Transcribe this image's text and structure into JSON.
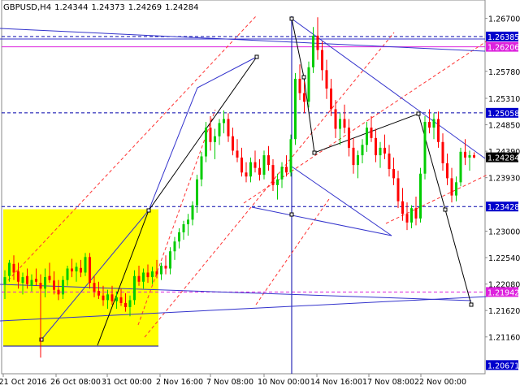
{
  "header": {
    "symbol": "GBPUSD,H4",
    "open": "1.24344",
    "high": "1.24373",
    "low": "1.24269",
    "close": "1.24284"
  },
  "colors": {
    "bull": "#00cc00",
    "bear": "#ff0000",
    "grid": "#c8c8c8",
    "level": "#0000aa",
    "channel": "#ff3333",
    "magenta": "#dd22dd",
    "pattern": "#3333cc",
    "zone": "#ffff00",
    "label_bg": "#0000cc"
  },
  "chart_data": {
    "type": "candlestick",
    "instrument": "GBPUSD",
    "timeframe": "H4",
    "ylim": [
      1.2052,
      1.2702
    ],
    "y_ticks": [
      "1.26700",
      "1.26385",
      "1.26206",
      "1.25780",
      "1.25310",
      "1.25058",
      "1.24850",
      "1.24390",
      "1.24284",
      "1.23930",
      "1.23428",
      "1.23000",
      "1.22540",
      "1.22080",
      "1.21942",
      "1.21620",
      "1.21160",
      "1.20671"
    ],
    "x_ticks": [
      "21 Oct 2016",
      "26 Oct 08:00",
      "31 Oct 00:00",
      "2 Nov 16:00",
      "7 Nov 08:00",
      "10 Nov 00:00",
      "14 Nov 16:00",
      "17 Nov 08:00",
      "22 Nov 00:00"
    ],
    "levels": [
      {
        "label": "1.26385",
        "value": 1.26385,
        "style": "dashed",
        "color": "#0000aa"
      },
      {
        "label": "1.26206",
        "value": 1.26206,
        "style": "solid",
        "color": "#dd22dd"
      },
      {
        "label": "1.25058",
        "value": 1.25058,
        "style": "dashed",
        "color": "#0000aa"
      },
      {
        "label": "1.24284",
        "value": 1.24284,
        "style": "current",
        "color": "#0000aa"
      },
      {
        "label": "1.23428",
        "value": 1.23428,
        "style": "dashed",
        "color": "#0000aa"
      },
      {
        "label": "1.21942",
        "value": 1.21942,
        "style": "dashed",
        "color": "#dd22dd"
      },
      {
        "label": "1.20671",
        "value": 1.20671,
        "style": "bottom",
        "color": "#0000aa"
      }
    ],
    "candles": [
      [
        1.2207,
        1.2232,
        1.2182,
        1.222
      ],
      [
        1.2222,
        1.225,
        1.2212,
        1.2245
      ],
      [
        1.2243,
        1.2258,
        1.2215,
        1.2228
      ],
      [
        1.223,
        1.2245,
        1.22,
        1.2212
      ],
      [
        1.221,
        1.2228,
        1.219,
        1.222
      ],
      [
        1.2222,
        1.2235,
        1.22,
        1.2208
      ],
      [
        1.2205,
        1.2225,
        1.2195,
        1.2215
      ],
      [
        1.2217,
        1.2235,
        1.2205,
        1.2212
      ],
      [
        1.221,
        1.2225,
        1.208,
        1.22
      ],
      [
        1.22,
        1.2235,
        1.2185,
        1.222
      ],
      [
        1.2222,
        1.2245,
        1.221,
        1.2215
      ],
      [
        1.2214,
        1.223,
        1.219,
        1.2198
      ],
      [
        1.2198,
        1.2215,
        1.218,
        1.219
      ],
      [
        1.219,
        1.2222,
        1.2182,
        1.2215
      ],
      [
        1.2215,
        1.224,
        1.2205,
        1.2235
      ],
      [
        1.2235,
        1.2252,
        1.222,
        1.223
      ],
      [
        1.223,
        1.2245,
        1.2212,
        1.2238
      ],
      [
        1.2236,
        1.225,
        1.222,
        1.2228
      ],
      [
        1.2228,
        1.2262,
        1.2222,
        1.2255
      ],
      [
        1.2255,
        1.2262,
        1.22,
        1.221
      ],
      [
        1.221,
        1.2222,
        1.2185,
        1.2195
      ],
      [
        1.2196,
        1.2212,
        1.2182,
        1.2188
      ],
      [
        1.2188,
        1.2205,
        1.217,
        1.218
      ],
      [
        1.218,
        1.2198,
        1.2165,
        1.219
      ],
      [
        1.219,
        1.2205,
        1.2172,
        1.2178
      ],
      [
        1.2178,
        1.2195,
        1.2165,
        1.2185
      ],
      [
        1.2185,
        1.22,
        1.217,
        1.2175
      ],
      [
        1.2175,
        1.2192,
        1.216,
        1.2168
      ],
      [
        1.2168,
        1.2188,
        1.2152,
        1.218
      ],
      [
        1.218,
        1.2232,
        1.2172,
        1.2222
      ],
      [
        1.2222,
        1.224,
        1.2205,
        1.2212
      ],
      [
        1.2212,
        1.2235,
        1.22,
        1.2228
      ],
      [
        1.2228,
        1.2242,
        1.221,
        1.222
      ],
      [
        1.222,
        1.2238,
        1.2208,
        1.223
      ],
      [
        1.223,
        1.225,
        1.2218,
        1.2225
      ],
      [
        1.2225,
        1.2245,
        1.2215,
        1.224
      ],
      [
        1.224,
        1.2258,
        1.2225,
        1.2235
      ],
      [
        1.2235,
        1.2272,
        1.2225,
        1.2265
      ],
      [
        1.2265,
        1.229,
        1.225,
        1.2282
      ],
      [
        1.2282,
        1.2305,
        1.227,
        1.2298
      ],
      [
        1.2298,
        1.2318,
        1.2285,
        1.2312
      ],
      [
        1.2312,
        1.233,
        1.2292,
        1.232
      ],
      [
        1.232,
        1.2352,
        1.231,
        1.2345
      ],
      [
        1.2345,
        1.2398,
        1.2332,
        1.239
      ],
      [
        1.239,
        1.2438,
        1.2378,
        1.243
      ],
      [
        1.243,
        1.249,
        1.242,
        1.248
      ],
      [
        1.248,
        1.25,
        1.244,
        1.2455
      ],
      [
        1.2455,
        1.2478,
        1.2425,
        1.2465
      ],
      [
        1.2465,
        1.2495,
        1.245,
        1.2488
      ],
      [
        1.2488,
        1.251,
        1.247,
        1.2495
      ],
      [
        1.2495,
        1.2505,
        1.2455,
        1.2465
      ],
      [
        1.2465,
        1.248,
        1.2432,
        1.244
      ],
      [
        1.244,
        1.246,
        1.242,
        1.2428
      ],
      [
        1.2428,
        1.2445,
        1.2395,
        1.2402
      ],
      [
        1.2402,
        1.242,
        1.2385,
        1.2395
      ],
      [
        1.2395,
        1.2428,
        1.2385,
        1.242
      ],
      [
        1.242,
        1.244,
        1.2402,
        1.241
      ],
      [
        1.241,
        1.2425,
        1.2388,
        1.2398
      ],
      [
        1.2398,
        1.244,
        1.239,
        1.2432
      ],
      [
        1.2432,
        1.2448,
        1.2405,
        1.2415
      ],
      [
        1.2415,
        1.2425,
        1.237,
        1.238
      ],
      [
        1.238,
        1.24,
        1.2355,
        1.239
      ],
      [
        1.239,
        1.242,
        1.2375,
        1.2412
      ],
      [
        1.2412,
        1.2432,
        1.2395,
        1.2402
      ],
      [
        1.2402,
        1.2468,
        1.2395,
        1.246
      ],
      [
        1.246,
        1.2575,
        1.245,
        1.2565
      ],
      [
        1.2565,
        1.259,
        1.2528,
        1.254
      ],
      [
        1.254,
        1.256,
        1.2505,
        1.2525
      ],
      [
        1.2525,
        1.2595,
        1.2515,
        1.2585
      ],
      [
        1.2585,
        1.2655,
        1.2575,
        1.264
      ],
      [
        1.264,
        1.2672,
        1.2598,
        1.2615
      ],
      [
        1.2615,
        1.263,
        1.2562,
        1.258
      ],
      [
        1.258,
        1.2598,
        1.253,
        1.2548
      ],
      [
        1.2548,
        1.2565,
        1.25,
        1.2512
      ],
      [
        1.2512,
        1.2528,
        1.2462,
        1.2478
      ],
      [
        1.2478,
        1.2505,
        1.245,
        1.2495
      ],
      [
        1.2495,
        1.252,
        1.247,
        1.248
      ],
      [
        1.248,
        1.2495,
        1.243,
        1.2445
      ],
      [
        1.2445,
        1.2462,
        1.24,
        1.2415
      ],
      [
        1.2415,
        1.244,
        1.2392,
        1.2432
      ],
      [
        1.2432,
        1.246,
        1.2418,
        1.245
      ],
      [
        1.245,
        1.249,
        1.2438,
        1.248
      ],
      [
        1.248,
        1.25,
        1.2455,
        1.2462
      ],
      [
        1.2462,
        1.2478,
        1.242,
        1.2432
      ],
      [
        1.2432,
        1.2455,
        1.241,
        1.2445
      ],
      [
        1.2445,
        1.2468,
        1.2425,
        1.2435
      ],
      [
        1.2435,
        1.245,
        1.2395,
        1.2408
      ],
      [
        1.2408,
        1.2428,
        1.238,
        1.2392
      ],
      [
        1.2392,
        1.2405,
        1.234,
        1.2352
      ],
      [
        1.2352,
        1.2375,
        1.2318,
        1.233
      ],
      [
        1.233,
        1.235,
        1.2302,
        1.2315
      ],
      [
        1.2315,
        1.2345,
        1.2305,
        1.234
      ],
      [
        1.234,
        1.236,
        1.231,
        1.2322
      ],
      [
        1.2322,
        1.241,
        1.2315,
        1.24
      ],
      [
        1.24,
        1.25,
        1.239,
        1.249
      ],
      [
        1.249,
        1.2512,
        1.247,
        1.248
      ],
      [
        1.248,
        1.2505,
        1.246,
        1.2495
      ],
      [
        1.2495,
        1.2508,
        1.2445,
        1.2455
      ],
      [
        1.2455,
        1.247,
        1.2405,
        1.2418
      ],
      [
        1.2418,
        1.2435,
        1.238,
        1.2392
      ],
      [
        1.2392,
        1.241,
        1.235,
        1.2362
      ],
      [
        1.2362,
        1.2395,
        1.2352,
        1.2385
      ],
      [
        1.2385,
        1.2445,
        1.2378,
        1.2438
      ],
      [
        1.2438,
        1.246,
        1.2415,
        1.2428
      ],
      [
        1.2428,
        1.244,
        1.2405,
        1.2432
      ],
      [
        1.2432,
        1.2437,
        1.2427,
        1.2428
      ]
    ]
  }
}
